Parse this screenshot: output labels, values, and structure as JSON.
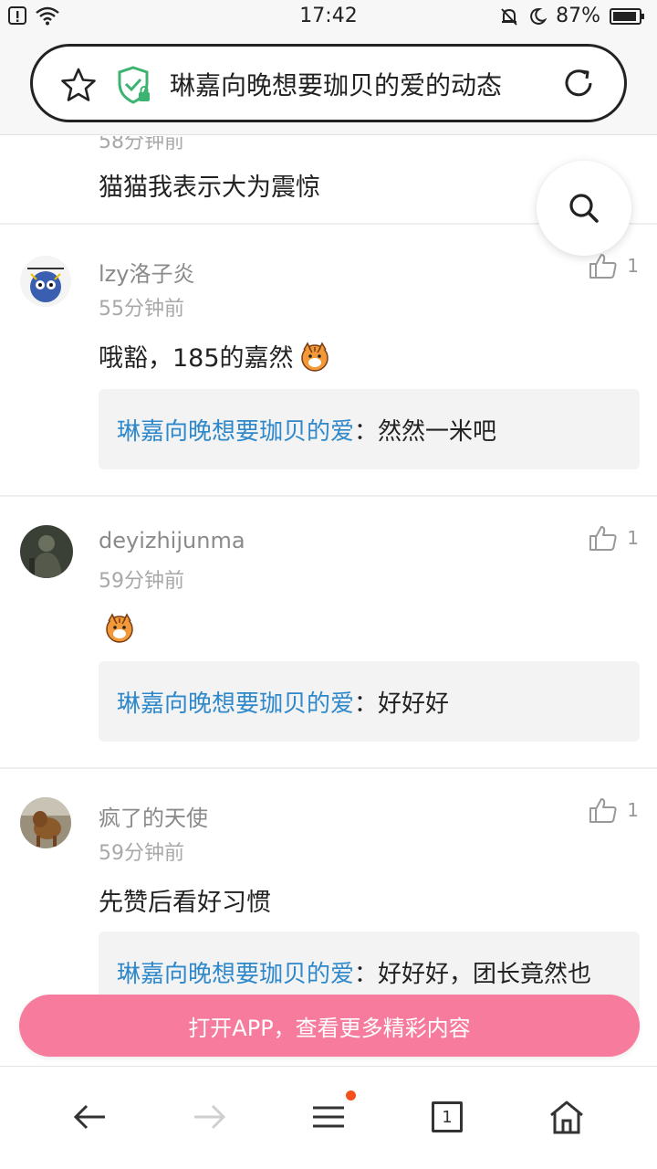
{
  "status_bar": {
    "time": "17:42",
    "battery": "87%"
  },
  "address_bar": {
    "title": "琳嘉向晚想要珈贝的爱的动态"
  },
  "previous_comment": {
    "time": "58分钟前",
    "text": "猫猫我表示大为震惊"
  },
  "comments": [
    {
      "username": "lzy洛子炎",
      "time": "55分钟前",
      "text": "哦豁，185的嘉然",
      "likes": "1",
      "reply": {
        "name": "琳嘉向晚想要珈贝的爱",
        "separator": "：",
        "text": "然然一米吧"
      }
    },
    {
      "username": "deyizhijunma",
      "time": "59分钟前",
      "text": "",
      "likes": "1",
      "reply": {
        "name": "琳嘉向晚想要珈贝的爱",
        "separator": "：",
        "text": "好好好"
      }
    },
    {
      "username": "疯了的天使",
      "time": "59分钟前",
      "text": "先赞后看好习惯",
      "likes": "1",
      "reply": {
        "name": "琳嘉向晚想要珈贝的爱",
        "separator": "：",
        "text": "好好好，团长竟然也"
      }
    }
  ],
  "open_app_banner": {
    "label": "打开APP，查看更多精彩内容"
  },
  "bottom_nav": {
    "tab_count": "1"
  },
  "colors": {
    "accent_pink": "#f67b9c",
    "link_blue": "#2f88c9",
    "shield_green": "#3cb371"
  }
}
